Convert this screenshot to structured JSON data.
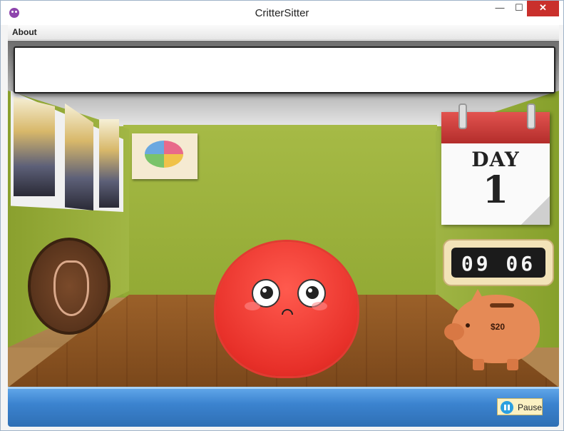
{
  "window": {
    "title": "CritterSitter",
    "minimize_glyph": "—",
    "maximize_glyph": "☐",
    "close_glyph": "✕"
  },
  "menu": {
    "items": [
      "About"
    ]
  },
  "scene": {
    "speech_text": "",
    "calendar": {
      "heading": "DAY",
      "day_number": "1"
    },
    "clock": {
      "time": "09 06"
    },
    "piggy_bank": {
      "money": "$20"
    }
  },
  "controls": {
    "pause_label": "Pause"
  },
  "colors": {
    "critter_red": "#e8312a",
    "bottom_bar_blue": "#3b83cf",
    "calendar_red": "#c83a37",
    "piggy_orange": "#e58a56"
  },
  "icons": [
    "app-critter-icon",
    "pause-icon"
  ]
}
